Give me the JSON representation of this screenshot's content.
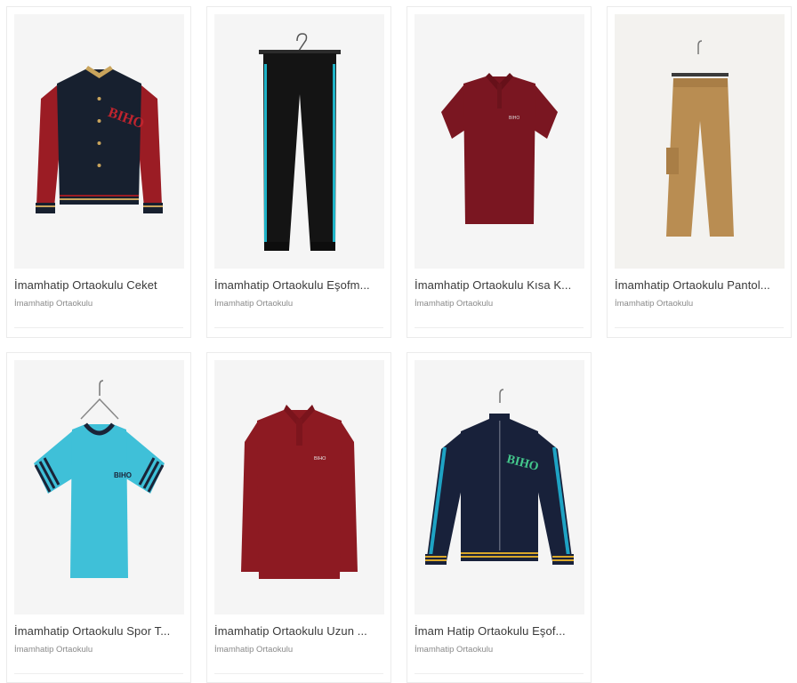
{
  "products": [
    {
      "title": "İmamhatip Ortaokulu Ceket",
      "brand": "İmamhatip Ortaokulu",
      "image": "varsity-jacket-image",
      "colors": {
        "body": "#17202f",
        "sleeve": "#9b1c24"
      }
    },
    {
      "title": "İmamhatip Ortaokulu Eşofm...",
      "brand": "İmamhatip Ortaokulu",
      "image": "track-pants-image",
      "colors": {
        "body": "#141414",
        "stripe": "#1fb3c7"
      }
    },
    {
      "title": "İmamhatip Ortaokulu Kısa K...",
      "brand": "İmamhatip Ortaokulu",
      "image": "polo-shirt-image",
      "colors": {
        "body": "#7a1621"
      }
    },
    {
      "title": "İmamhatip Ortaokulu Pantol...",
      "brand": "İmamhatip Ortaokulu",
      "image": "chino-pants-image",
      "colors": {
        "body": "#b98d52"
      }
    },
    {
      "title": "İmamhatip Ortaokulu Spor T...",
      "brand": "İmamhatip Ortaokulu",
      "image": "sport-tshirt-image",
      "colors": {
        "body": "#3fc0d8",
        "trim": "#1a2438"
      }
    },
    {
      "title": "İmamhatip Ortaokulu Uzun ...",
      "brand": "İmamhatip Ortaokulu",
      "image": "long-sleeve-polo-image",
      "colors": {
        "body": "#8d1a22"
      }
    },
    {
      "title": "İmam Hatip Ortaokulu Eşof...",
      "brand": "İmamhatip Ortaokulu",
      "image": "track-jacket-image",
      "colors": {
        "body": "#18213a",
        "stripe": "#1ea3c4",
        "trim": "#d9a72a"
      }
    }
  ]
}
